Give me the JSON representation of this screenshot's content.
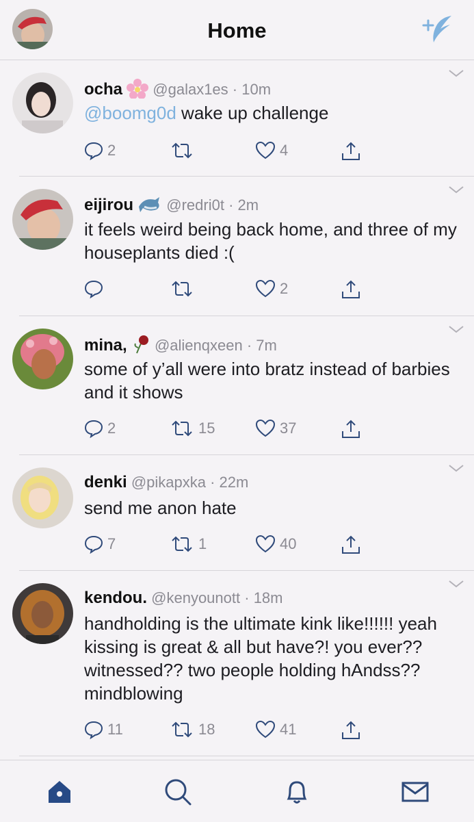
{
  "header": {
    "title": "Home"
  },
  "colors": {
    "accent": "#7fb2de",
    "tab_active": "#274a86",
    "text": "#1d1d22",
    "muted": "#8b8a92"
  },
  "tweets": [
    {
      "name": "ocha",
      "handle": "@galax1es",
      "time": "10m",
      "mention": "@boomg0d",
      "text": " wake up challenge",
      "replies": "2",
      "retweets": "",
      "likes": "4",
      "name_icon": "cherry-blossom-icon"
    },
    {
      "name": "eijirou",
      "handle": "@redri0t",
      "time": "2m",
      "text": "it feels weird being back home, and three of my houseplants died :(",
      "replies": "",
      "retweets": "",
      "likes": "2",
      "name_icon": "dolphin-icon"
    },
    {
      "name": "mina,",
      "handle": "@alienqxeen",
      "time": "7m",
      "text": "some of y’all were into bratz instead of barbies and it shows",
      "replies": "2",
      "retweets": "15",
      "likes": "37",
      "name_icon": "wilted-rose-icon"
    },
    {
      "name": "denki",
      "handle": "@pikapxka",
      "time": "22m",
      "text": "send me anon hate",
      "replies": "7",
      "retweets": "1",
      "likes": "40"
    },
    {
      "name": "kendou.",
      "handle": "@kenyounott",
      "time": "18m",
      "text": "handholding is the ultimate kink like!!!!!! yeah kissing is great & all but have?! you ever?? witnessed?? two people holding hAndss?? mindblowing",
      "replies": "11",
      "retweets": "18",
      "likes": "41"
    }
  ],
  "tabbar": {
    "tabs": [
      "home-icon",
      "search-icon",
      "notifications-icon",
      "messages-icon"
    ]
  }
}
